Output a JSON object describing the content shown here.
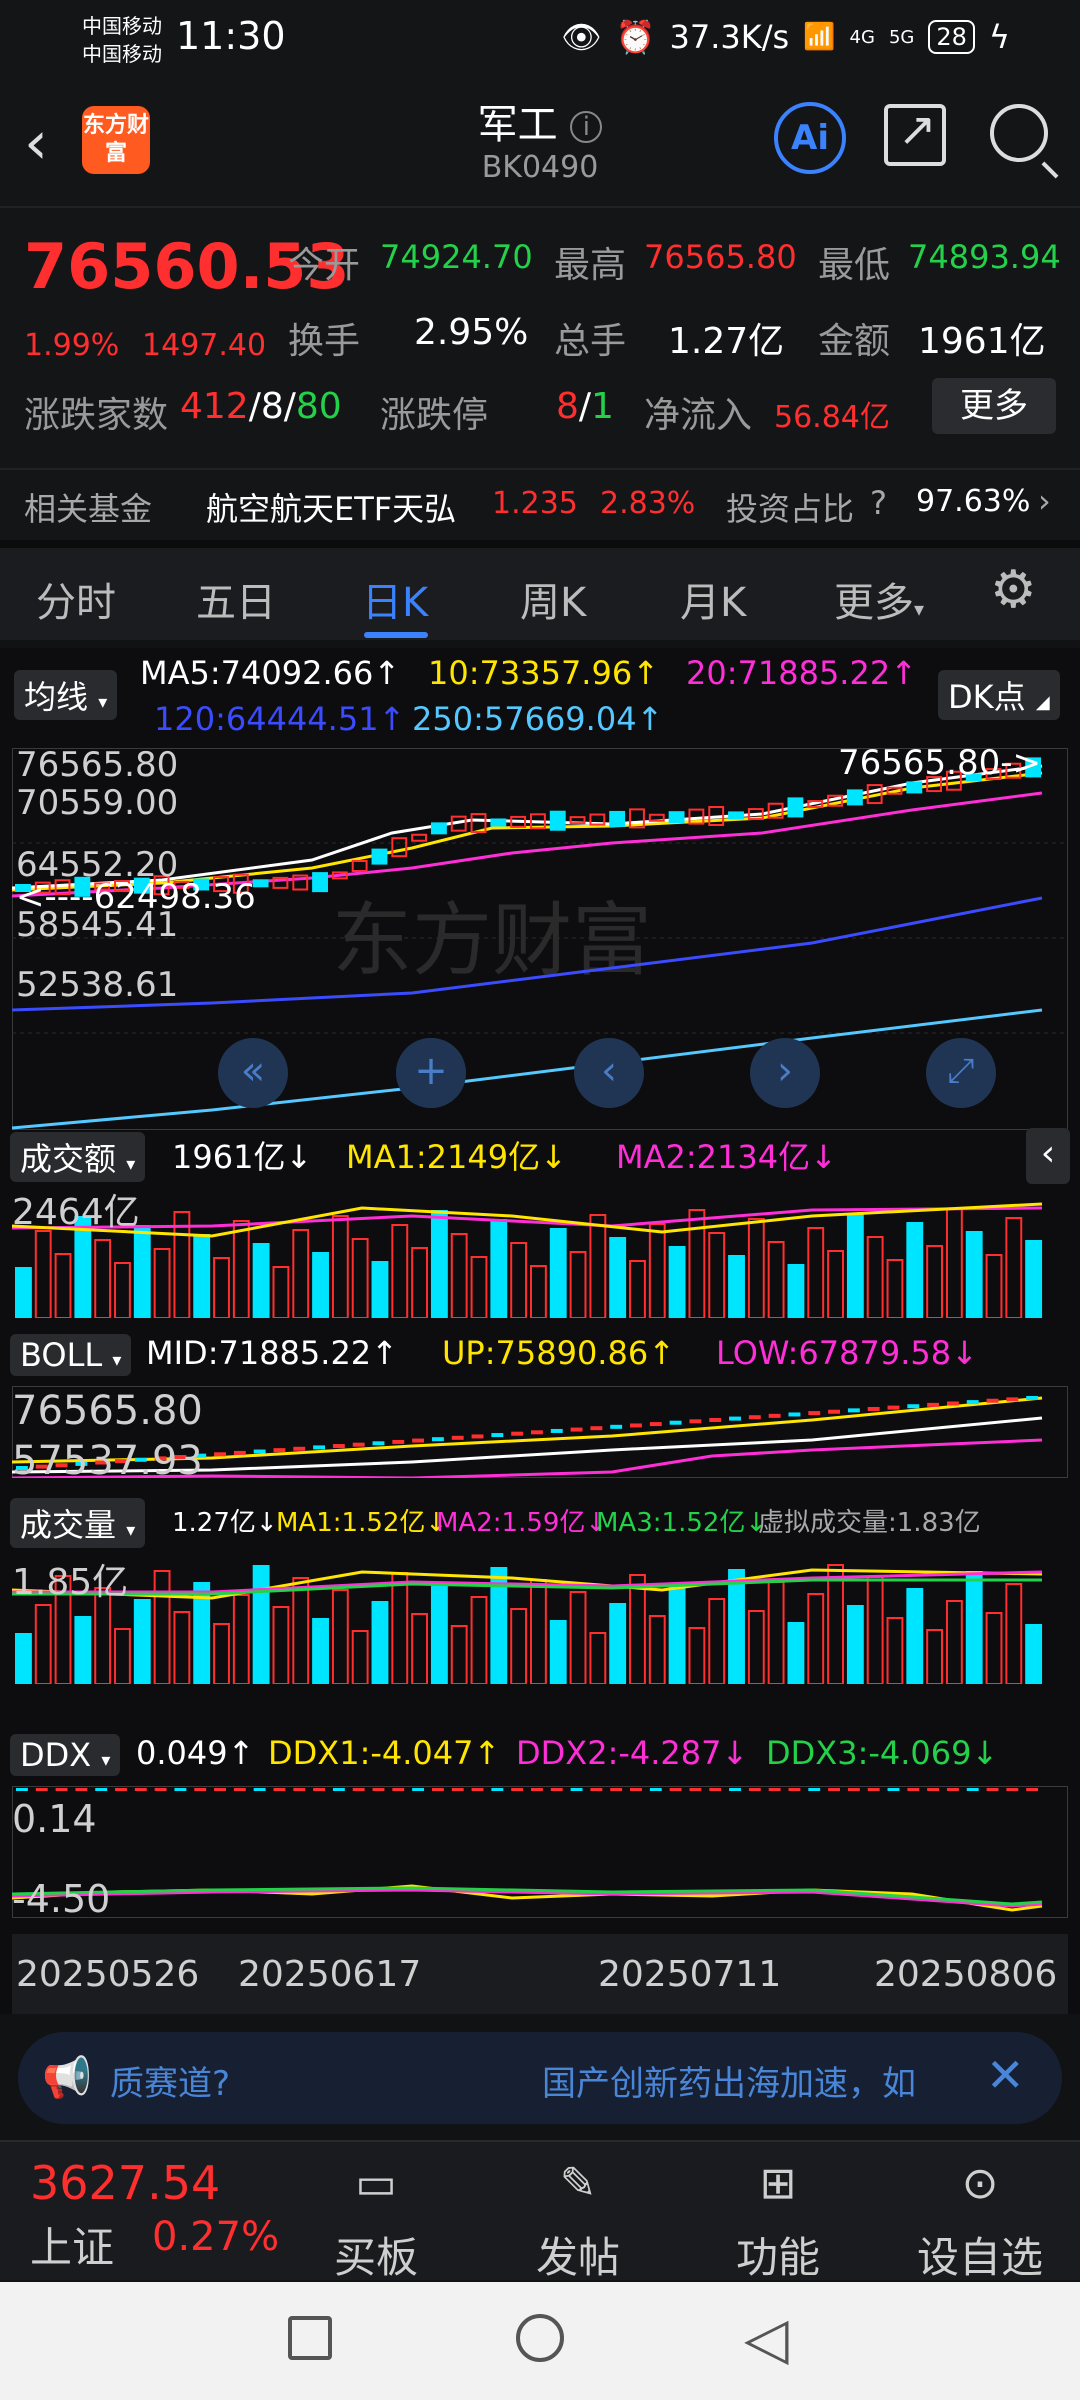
{
  "status": {
    "carrier1": "中国移动",
    "carrier2": "中国移动",
    "time": "11:30",
    "net_speed": "37.3K/s",
    "signal1": "4G",
    "signal2": "5G",
    "battery": "28"
  },
  "header": {
    "logo": "东方财富",
    "title": "军工",
    "code": "BK0490",
    "ai_label": "Ai"
  },
  "quote": {
    "price": "76560.53",
    "pct": "1.99%",
    "change": "1497.40",
    "open_label": "今开",
    "open": "74924.70",
    "high_label": "最高",
    "high": "76565.80",
    "low_label": "最低",
    "low": "74893.94",
    "turnover_label": "换手",
    "turnover": "2.95%",
    "volume_label": "总手",
    "volume": "1.27亿",
    "amount_label": "金额",
    "amount": "1961亿",
    "breadth_label": "涨跌家数",
    "up": "412",
    "flat": "8",
    "down": "80",
    "limit_label": "涨跌停",
    "limit_up": "8",
    "limit_down": "1",
    "inflow_label": "净流入",
    "inflow": "56.84亿",
    "more_label": "更多"
  },
  "related": {
    "label": "相关基金",
    "fund": "航空航天ETF天弘",
    "fund_price": "1.235",
    "fund_pct": "2.83%",
    "ratio_label": "投资占比",
    "ratio": "97.63%"
  },
  "tabs": [
    "分时",
    "五日",
    "日K",
    "周K",
    "月K",
    "更多"
  ],
  "chart": {
    "ma_select": "均线",
    "ma5": "MA5:74092.66↑",
    "ma10": "10:73357.96↑",
    "ma20": "20:71885.22↑",
    "ma120": "120:64444.51↑",
    "ma250": "250:57669.04↑",
    "dk_label": "DK点",
    "y_labels": [
      "76565.80",
      "70559.00",
      "64552.20",
      "58545.41",
      "52538.61"
    ],
    "high_marker": "76565.80->",
    "low_marker": "<----62498.36",
    "amount_select": "成交额",
    "amount_val": "1961亿↓",
    "amount_ma1": "MA1:2149亿↓",
    "amount_ma2": "MA2:2134亿↓",
    "amount_axis": "2464亿",
    "boll_select": "BOLL",
    "boll_mid": "MID:71885.22↑",
    "boll_up": "UP:75890.86↑",
    "boll_low": "LOW:67879.58↓",
    "boll_axis_top": "76565.80",
    "boll_axis_bottom": "57537.93",
    "vol_select": "成交量",
    "vol_val": "1.27亿↓",
    "vol_ma1": "MA1:1.52亿↓",
    "vol_ma2": "MA2:1.59亿↓",
    "vol_ma3": "MA3:1.52亿↓",
    "vol_virtual": "虚拟成交量:1.83亿",
    "vol_axis": "1.85亿",
    "ddx_select": "DDX",
    "ddx_val": "0.049↑",
    "ddx1": "DDX1:-4.047↑",
    "ddx2": "DDX2:-4.287↓",
    "ddx3": "DDX3:-4.069↓",
    "ddx_axis_top": "0.14",
    "ddx_axis_bottom": "-4.50",
    "dates": [
      "20250526",
      "20250617",
      "20250711",
      "20250806"
    ],
    "colors": {
      "up": "#ff2f2f",
      "down": "#00e5ff",
      "ma5": "#ffffff",
      "ma10": "#ffe500",
      "ma20": "#ff2fd8",
      "ma120": "#3b4cff",
      "ma250": "#55c8ff"
    }
  },
  "news": {
    "left_text": "质赛道?",
    "right_text": "国产创新药出海加速，如"
  },
  "bottom": {
    "index_price": "3627.54",
    "index_name": "上证",
    "index_pct": "0.27%",
    "items": [
      "买板块",
      "发帖",
      "功能",
      "设自选"
    ]
  }
}
